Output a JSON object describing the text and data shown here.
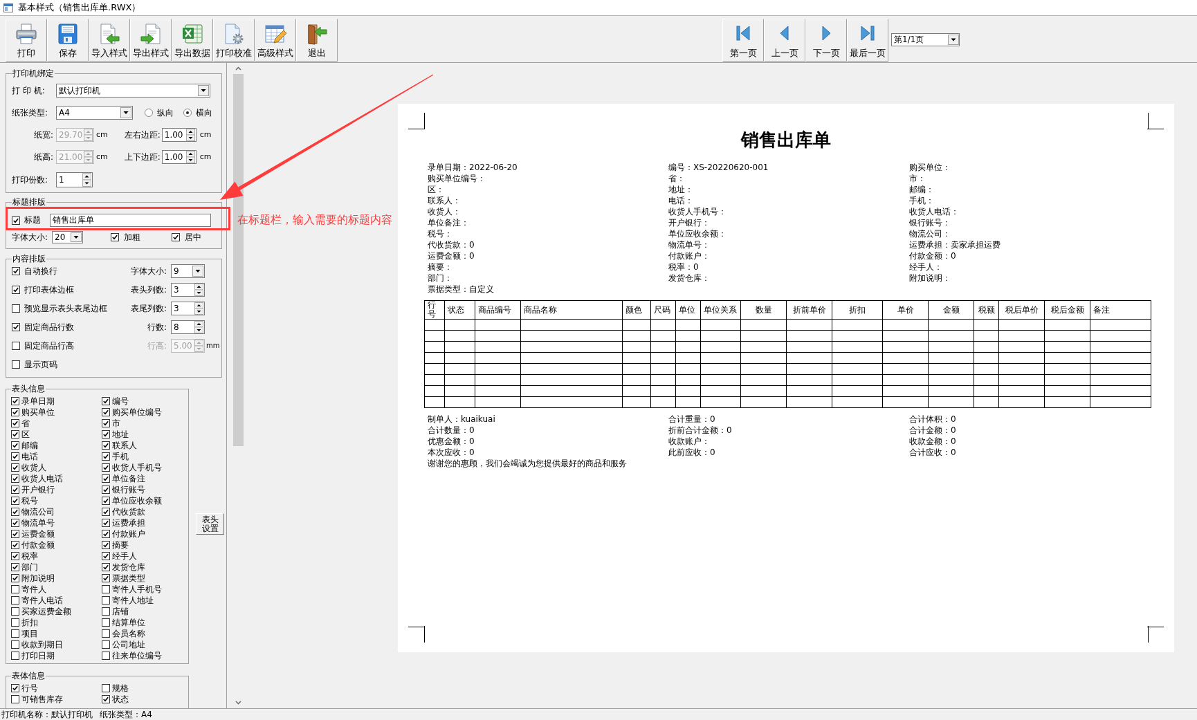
{
  "window": {
    "title": "基本样式（销售出库单.RWX）"
  },
  "toolbar": [
    {
      "kind": "print",
      "label": "打印"
    },
    {
      "kind": "save",
      "label": "保存"
    },
    {
      "kind": "import",
      "label": "导入样式"
    },
    {
      "kind": "export",
      "label": "导出样式"
    },
    {
      "kind": "export_data",
      "label": "导出数据"
    },
    {
      "kind": "calibrate",
      "label": "打印校准"
    },
    {
      "kind": "advanced",
      "label": "高级样式"
    },
    {
      "kind": "exit",
      "label": "退出"
    }
  ],
  "pager": {
    "buttons": [
      {
        "kind": "first",
        "label": "第一页"
      },
      {
        "kind": "previous",
        "label": "上一页"
      },
      {
        "kind": "next",
        "label": "下一页"
      },
      {
        "kind": "last",
        "label": "最后一页"
      }
    ],
    "page": "第1/1页"
  },
  "printer_binding": {
    "title": "打印机绑定",
    "printer": {
      "label": "打 印 机:",
      "value": "默认打印机"
    },
    "paper_type": {
      "label": "纸张类型:",
      "value": "A4"
    },
    "orientation": [
      {
        "label": "纵向",
        "selected": false
      },
      {
        "label": "横向",
        "selected": true
      }
    ],
    "paper_width": {
      "label": "纸宽:",
      "value": "29.70",
      "unit": "cm",
      "disabled": true
    },
    "lr_margin": {
      "label": "左右边距:",
      "value": "1.00",
      "unit": "cm",
      "disabled": false
    },
    "paper_height": {
      "label": "纸高:",
      "value": "21.00",
      "unit": "cm",
      "disabled": true
    },
    "tb_margin": {
      "label": "上下边距:",
      "value": "1.00",
      "unit": "cm",
      "disabled": false
    },
    "copies": {
      "label": "打印份数:",
      "value": "1",
      "disabled": false
    }
  },
  "title_layout": {
    "title": "标题排版",
    "show_title": {
      "label": "标题",
      "checked": true
    },
    "title_text": "销售出库单",
    "font_size": {
      "label": "字体大小:",
      "value": "20"
    },
    "bold": {
      "label": "加粗",
      "checked": true
    },
    "centered": {
      "label": "居中",
      "checked": true
    }
  },
  "content_layout": {
    "title": "内容排版",
    "rows": [
      {
        "label": "自动换行",
        "checked": true,
        "setting": {
          "kind": "combo",
          "label": "字体大小:",
          "value": "9",
          "disabled": false
        }
      },
      {
        "label": "打印表体边框",
        "checked": true,
        "setting": {
          "kind": "spin",
          "label": "表头列数:",
          "value": "3",
          "disabled": false
        }
      },
      {
        "label": "预览显示表头表尾边框",
        "checked": false,
        "setting": {
          "kind": "spin",
          "label": "表尾列数:",
          "value": "3",
          "disabled": false
        }
      },
      {
        "label": "固定商品行数",
        "checked": true,
        "setting": {
          "kind": "spin",
          "label": "行数:",
          "value": "8",
          "disabled": false
        }
      },
      {
        "label": "固定商品行高",
        "checked": false,
        "setting": {
          "kind": "spin",
          "label": "行高:",
          "value": "5.00",
          "unit": "mm",
          "disabled": true
        }
      },
      {
        "label": "显示页码",
        "checked": false
      }
    ]
  },
  "header_fields": {
    "title": "表头信息",
    "items": [
      {
        "label": "录单日期",
        "checked": true
      },
      {
        "label": "编号",
        "checked": true
      },
      {
        "label": "购买单位",
        "checked": true
      },
      {
        "label": "购买单位编号",
        "checked": true
      },
      {
        "label": "省",
        "checked": true
      },
      {
        "label": "市",
        "checked": true
      },
      {
        "label": "区",
        "checked": true
      },
      {
        "label": "地址",
        "checked": true
      },
      {
        "label": "邮编",
        "checked": true
      },
      {
        "label": "联系人",
        "checked": true
      },
      {
        "label": "电话",
        "checked": true
      },
      {
        "label": "手机",
        "checked": true
      },
      {
        "label": "收货人",
        "checked": true
      },
      {
        "label": "收货人手机号",
        "checked": true
      },
      {
        "label": "收货人电话",
        "checked": true
      },
      {
        "label": "单位备注",
        "checked": true
      },
      {
        "label": "开户银行",
        "checked": true
      },
      {
        "label": "银行账号",
        "checked": true
      },
      {
        "label": "税号",
        "checked": true
      },
      {
        "label": "单位应收余额",
        "checked": true
      },
      {
        "label": "物流公司",
        "checked": true
      },
      {
        "label": "代收货款",
        "checked": true
      },
      {
        "label": "物流单号",
        "checked": true
      },
      {
        "label": "运费承担",
        "checked": true
      },
      {
        "label": "运费金额",
        "checked": true
      },
      {
        "label": "付款账户",
        "checked": true
      },
      {
        "label": "付款金额",
        "checked": true
      },
      {
        "label": "摘要",
        "checked": true
      },
      {
        "label": "税率",
        "checked": true
      },
      {
        "label": "经手人",
        "checked": true
      },
      {
        "label": "部门",
        "checked": true
      },
      {
        "label": "发货仓库",
        "checked": true
      },
      {
        "label": "附加说明",
        "checked": true
      },
      {
        "label": "票据类型",
        "checked": true
      },
      {
        "label": "寄件人",
        "checked": false
      },
      {
        "label": "寄件人手机号",
        "checked": false
      },
      {
        "label": "寄件人电话",
        "checked": false
      },
      {
        "label": "寄件人地址",
        "checked": false
      },
      {
        "label": "买家运费金额",
        "checked": false
      },
      {
        "label": "店铺",
        "checked": false
      },
      {
        "label": "折扣",
        "checked": false
      },
      {
        "label": "结算单位",
        "checked": false
      },
      {
        "label": "项目",
        "checked": false
      },
      {
        "label": "会员名称",
        "checked": false
      },
      {
        "label": "收款到期日",
        "checked": false
      },
      {
        "label": "公司地址",
        "checked": false
      },
      {
        "label": "打印日期",
        "checked": false
      },
      {
        "label": "往来单位编号",
        "checked": false
      }
    ],
    "button": "表头设置"
  },
  "body_fields": {
    "title": "表体信息",
    "items": [
      {
        "label": "行号",
        "checked": true
      },
      {
        "label": "规格",
        "checked": false
      },
      {
        "label": "可销售库存",
        "checked": false
      },
      {
        "label": "状态",
        "checked": true
      }
    ]
  },
  "annotation": {
    "text": "在标题栏，输入需要的标题内容"
  },
  "document": {
    "title": "销售出库单",
    "header": [
      "录单日期：2022-06-20",
      "编号：XS-20220620-001",
      "购买单位：",
      "购买单位编号：",
      "省：",
      "市：",
      "区：",
      "地址：",
      "邮编：",
      "联系人：",
      "电话：",
      "手机：",
      "收货人：",
      "收货人手机号：",
      "收货人电话：",
      "单位备注：",
      "开户银行：",
      "银行账号：",
      "税号：",
      "单位应收余额：",
      "物流公司：",
      "代收货款：0",
      "物流单号：",
      "运费承担：卖家承担运费",
      "运费金额：0",
      "付款账户：",
      "付款金额：0",
      "摘要：",
      "税率：0",
      "经手人：",
      "部门：",
      "发货仓库：",
      "附加说明：",
      "票据类型：自定义"
    ],
    "columns": [
      "行号",
      "状态",
      "商品编号",
      "商品名称",
      "颜色",
      "尺码",
      "单位",
      "单位关系",
      "数量",
      "折前单价",
      "折扣",
      "单价",
      "金额",
      "税额",
      "税后单价",
      "税后金额",
      "备注"
    ],
    "rows": [
      {
        "kind": "blank"
      },
      {
        "kind": "blank"
      },
      {
        "kind": "blank"
      },
      {
        "kind": "blank"
      },
      {
        "kind": "blank"
      },
      {
        "kind": "blank"
      },
      {
        "kind": "blank"
      },
      {
        "kind": "blank"
      }
    ],
    "footer": [
      "制单人：kuaikuai",
      "合计重量：0",
      "合计体积：0",
      "合计数量：0",
      "折前合计金额：0",
      "合计金额：0",
      "优惠金额：0",
      "收款账户：",
      "收款金额：0",
      "本次应收：0",
      "此前应收：0",
      "合计应收：0"
    ],
    "note": "谢谢您的惠顾，我们会竭诚为您提供最好的商品和服务"
  },
  "status_bar": [
    "打印机名称：默认打印机",
    "纸张类型：A4"
  ]
}
